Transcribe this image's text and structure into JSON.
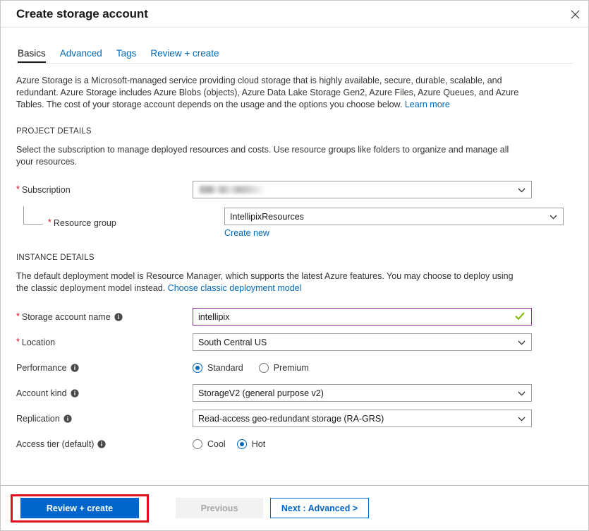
{
  "window": {
    "title": "Create storage account",
    "close_icon": "close-icon"
  },
  "tabs": [
    {
      "label": "Basics",
      "active": true
    },
    {
      "label": "Advanced",
      "active": false
    },
    {
      "label": "Tags",
      "active": false
    },
    {
      "label": "Review + create",
      "active": false
    }
  ],
  "intro": {
    "text": "Azure Storage is a Microsoft-managed service providing cloud storage that is highly available, secure, durable, scalable, and redundant. Azure Storage includes Azure Blobs (objects), Azure Data Lake Storage Gen2, Azure Files, Azure Queues, and Azure Tables. The cost of your storage account depends on the usage and the options you choose below. ",
    "link": "Learn more"
  },
  "project_details": {
    "heading": "PROJECT DETAILS",
    "description": "Select the subscription to manage deployed resources and costs. Use resource groups like folders to organize and manage all your resources.",
    "subscription": {
      "label": "Subscription",
      "required": true,
      "value": "",
      "redacted": true
    },
    "resource_group": {
      "label": "Resource group",
      "required": true,
      "value": "IntellipixResources",
      "create_new_link": "Create new"
    }
  },
  "instance_details": {
    "heading": "INSTANCE DETAILS",
    "description": "The default deployment model is Resource Manager, which supports the latest Azure features. You may choose to deploy using the classic deployment model instead. ",
    "description_link": "Choose classic deployment model",
    "storage_account_name": {
      "label": "Storage account name",
      "required": true,
      "has_info": true,
      "value": "intellipix",
      "validated": true
    },
    "location": {
      "label": "Location",
      "required": true,
      "value": "South Central US"
    },
    "performance": {
      "label": "Performance",
      "has_info": true,
      "options": [
        {
          "label": "Standard",
          "selected": true
        },
        {
          "label": "Premium",
          "selected": false
        }
      ]
    },
    "account_kind": {
      "label": "Account kind",
      "has_info": true,
      "value": "StorageV2 (general purpose v2)"
    },
    "replication": {
      "label": "Replication",
      "has_info": true,
      "value": "Read-access geo-redundant storage (RA-GRS)"
    },
    "access_tier": {
      "label": "Access tier (default)",
      "has_info": true,
      "options": [
        {
          "label": "Cool",
          "selected": false
        },
        {
          "label": "Hot",
          "selected": true
        }
      ]
    }
  },
  "footer": {
    "review_create": "Review + create",
    "previous": "Previous",
    "next": "Next : Advanced >"
  },
  "colors": {
    "accent_blue": "#0066cc",
    "link_blue": "#0067b8",
    "required_red": "#e00b1c",
    "annotation_red": "#e01020",
    "validation_purple": "#8a2f9b",
    "check_green": "#7ab800"
  }
}
